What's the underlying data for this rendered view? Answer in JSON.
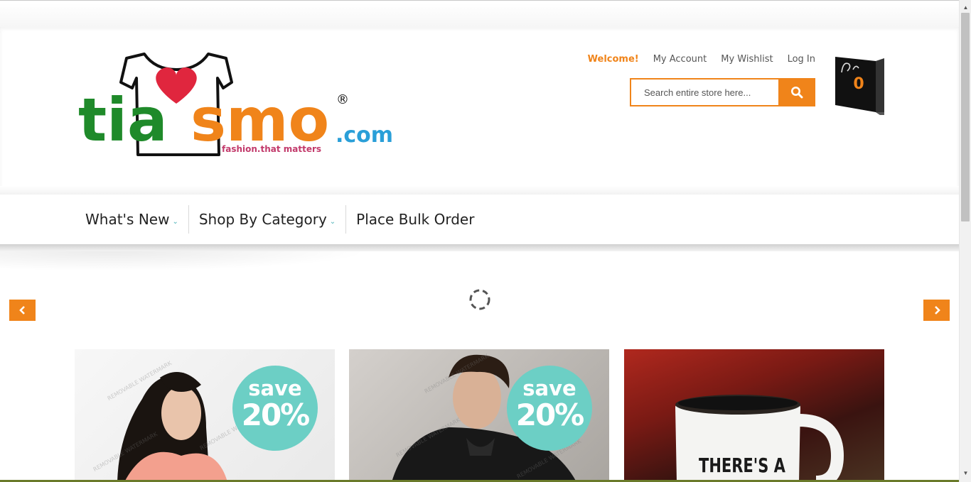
{
  "brand": {
    "logo_text_green": "tia",
    "logo_text_orange": "smo",
    "logo_domain": ".com",
    "logo_registered": "®",
    "tagline": "fashion.that matters"
  },
  "top_links": {
    "welcome": "Welcome!",
    "account": "My Account",
    "wishlist": "My Wishlist",
    "login": "Log In"
  },
  "search": {
    "placeholder": "Search entire store here...",
    "icon": "search-icon"
  },
  "cart": {
    "count": "0",
    "icon": "shopping-bag-icon"
  },
  "nav": {
    "items": [
      {
        "label": "What's New",
        "has_dropdown": true
      },
      {
        "label": "Shop By Category",
        "has_dropdown": true
      },
      {
        "label": "Place Bulk Order",
        "has_dropdown": false
      }
    ]
  },
  "slider": {
    "prev_icon": "chevron-left-icon",
    "next_icon": "chevron-right-icon",
    "loading_icon": "spinner-icon"
  },
  "banners": [
    {
      "badge_top": "save",
      "badge_bottom": "20%",
      "watermark": "REMOVABLE WATERMARK"
    },
    {
      "badge_top": "save",
      "badge_bottom": "20%",
      "watermark": "REMOVABLE WATERMARK"
    },
    {
      "mug_text": "THERE'S A"
    }
  ],
  "colors": {
    "accent_orange": "#f0841a",
    "logo_green": "#1f8a2a",
    "badge_teal": "#6ccfc5",
    "domain_blue": "#2a9fd8",
    "heart_red": "#e0263e"
  }
}
